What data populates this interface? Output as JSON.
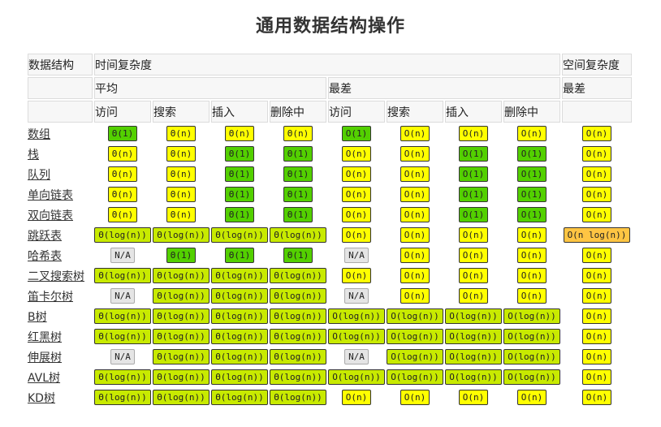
{
  "title": "通用数据结构操作",
  "headers": {
    "structure": "数据结构",
    "time": "时间复杂度",
    "space": "空间复杂度",
    "average": "平均",
    "worst": "最差",
    "space_worst": "最差",
    "ops": [
      "访问",
      "搜索",
      "插入",
      "删除中",
      "访问",
      "搜索",
      "插入",
      "删除中"
    ]
  },
  "colors": {
    "g": "#53d000",
    "lg": "#c8ea00",
    "y": "#ffff00",
    "o": "#ffc543",
    "na": "#e5e5e5"
  },
  "rows": [
    {
      "name": "数组",
      "cells": [
        [
          "Θ(1)",
          "g"
        ],
        [
          "Θ(n)",
          "y"
        ],
        [
          "Θ(n)",
          "y"
        ],
        [
          "Θ(n)",
          "y"
        ],
        [
          "O(1)",
          "g"
        ],
        [
          "O(n)",
          "y"
        ],
        [
          "O(n)",
          "y"
        ],
        [
          "O(n)",
          "y"
        ],
        [
          "O(n)",
          "y"
        ]
      ]
    },
    {
      "name": "栈",
      "cells": [
        [
          "Θ(n)",
          "y"
        ],
        [
          "Θ(n)",
          "y"
        ],
        [
          "Θ(1)",
          "g"
        ],
        [
          "Θ(1)",
          "g"
        ],
        [
          "O(n)",
          "y"
        ],
        [
          "O(n)",
          "y"
        ],
        [
          "O(1)",
          "g"
        ],
        [
          "O(1)",
          "g"
        ],
        [
          "O(n)",
          "y"
        ]
      ]
    },
    {
      "name": "队列",
      "cells": [
        [
          "Θ(n)",
          "y"
        ],
        [
          "Θ(n)",
          "y"
        ],
        [
          "Θ(1)",
          "g"
        ],
        [
          "Θ(1)",
          "g"
        ],
        [
          "O(n)",
          "y"
        ],
        [
          "O(n)",
          "y"
        ],
        [
          "O(1)",
          "g"
        ],
        [
          "O(1)",
          "g"
        ],
        [
          "O(n)",
          "y"
        ]
      ]
    },
    {
      "name": "单向链表",
      "cells": [
        [
          "Θ(n)",
          "y"
        ],
        [
          "Θ(n)",
          "y"
        ],
        [
          "Θ(1)",
          "g"
        ],
        [
          "Θ(1)",
          "g"
        ],
        [
          "O(n)",
          "y"
        ],
        [
          "O(n)",
          "y"
        ],
        [
          "O(1)",
          "g"
        ],
        [
          "O(1)",
          "g"
        ],
        [
          "O(n)",
          "y"
        ]
      ]
    },
    {
      "name": "双向链表",
      "cells": [
        [
          "Θ(n)",
          "y"
        ],
        [
          "Θ(n)",
          "y"
        ],
        [
          "Θ(1)",
          "g"
        ],
        [
          "Θ(1)",
          "g"
        ],
        [
          "O(n)",
          "y"
        ],
        [
          "O(n)",
          "y"
        ],
        [
          "O(1)",
          "g"
        ],
        [
          "O(1)",
          "g"
        ],
        [
          "O(n)",
          "y"
        ]
      ]
    },
    {
      "name": "跳跃表",
      "cells": [
        [
          "Θ(log(n))",
          "lg"
        ],
        [
          "Θ(log(n))",
          "lg"
        ],
        [
          "Θ(log(n))",
          "lg"
        ],
        [
          "Θ(log(n))",
          "lg"
        ],
        [
          "O(n)",
          "y"
        ],
        [
          "O(n)",
          "y"
        ],
        [
          "O(n)",
          "y"
        ],
        [
          "O(n)",
          "y"
        ],
        [
          "O(n log(n))",
          "o"
        ]
      ]
    },
    {
      "name": "哈希表",
      "cells": [
        [
          "N/A",
          "na"
        ],
        [
          "Θ(1)",
          "g"
        ],
        [
          "Θ(1)",
          "g"
        ],
        [
          "Θ(1)",
          "g"
        ],
        [
          "N/A",
          "na"
        ],
        [
          "O(n)",
          "y"
        ],
        [
          "O(n)",
          "y"
        ],
        [
          "O(n)",
          "y"
        ],
        [
          "O(n)",
          "y"
        ]
      ]
    },
    {
      "name": "二叉搜索树",
      "cells": [
        [
          "Θ(log(n))",
          "lg"
        ],
        [
          "Θ(log(n))",
          "lg"
        ],
        [
          "Θ(log(n))",
          "lg"
        ],
        [
          "Θ(log(n))",
          "lg"
        ],
        [
          "O(n)",
          "y"
        ],
        [
          "O(n)",
          "y"
        ],
        [
          "O(n)",
          "y"
        ],
        [
          "O(n)",
          "y"
        ],
        [
          "O(n)",
          "y"
        ]
      ]
    },
    {
      "name": "笛卡尔树",
      "cells": [
        [
          "N/A",
          "na"
        ],
        [
          "Θ(log(n))",
          "lg"
        ],
        [
          "Θ(log(n))",
          "lg"
        ],
        [
          "Θ(log(n))",
          "lg"
        ],
        [
          "N/A",
          "na"
        ],
        [
          "O(n)",
          "y"
        ],
        [
          "O(n)",
          "y"
        ],
        [
          "O(n)",
          "y"
        ],
        [
          "O(n)",
          "y"
        ]
      ]
    },
    {
      "name": "B树",
      "cells": [
        [
          "Θ(log(n))",
          "lg"
        ],
        [
          "Θ(log(n))",
          "lg"
        ],
        [
          "Θ(log(n))",
          "lg"
        ],
        [
          "Θ(log(n))",
          "lg"
        ],
        [
          "O(log(n))",
          "lg"
        ],
        [
          "O(log(n))",
          "lg"
        ],
        [
          "O(log(n))",
          "lg"
        ],
        [
          "O(log(n))",
          "lg"
        ],
        [
          "O(n)",
          "y"
        ]
      ]
    },
    {
      "name": "红黑树",
      "cells": [
        [
          "Θ(log(n))",
          "lg"
        ],
        [
          "Θ(log(n))",
          "lg"
        ],
        [
          "Θ(log(n))",
          "lg"
        ],
        [
          "Θ(log(n))",
          "lg"
        ],
        [
          "O(log(n))",
          "lg"
        ],
        [
          "O(log(n))",
          "lg"
        ],
        [
          "O(log(n))",
          "lg"
        ],
        [
          "O(log(n))",
          "lg"
        ],
        [
          "O(n)",
          "y"
        ]
      ]
    },
    {
      "name": "伸展树",
      "cells": [
        [
          "N/A",
          "na"
        ],
        [
          "Θ(log(n))",
          "lg"
        ],
        [
          "Θ(log(n))",
          "lg"
        ],
        [
          "Θ(log(n))",
          "lg"
        ],
        [
          "N/A",
          "na"
        ],
        [
          "O(log(n))",
          "lg"
        ],
        [
          "O(log(n))",
          "lg"
        ],
        [
          "O(log(n))",
          "lg"
        ],
        [
          "O(n)",
          "y"
        ]
      ]
    },
    {
      "name": "AVL树",
      "cells": [
        [
          "Θ(log(n))",
          "lg"
        ],
        [
          "Θ(log(n))",
          "lg"
        ],
        [
          "Θ(log(n))",
          "lg"
        ],
        [
          "Θ(log(n))",
          "lg"
        ],
        [
          "O(log(n))",
          "lg"
        ],
        [
          "O(log(n))",
          "lg"
        ],
        [
          "O(log(n))",
          "lg"
        ],
        [
          "O(log(n))",
          "lg"
        ],
        [
          "O(n)",
          "y"
        ]
      ]
    },
    {
      "name": "KD树",
      "cells": [
        [
          "Θ(log(n))",
          "lg"
        ],
        [
          "Θ(log(n))",
          "lg"
        ],
        [
          "Θ(log(n))",
          "lg"
        ],
        [
          "Θ(log(n))",
          "lg"
        ],
        [
          "O(n)",
          "y"
        ],
        [
          "O(n)",
          "y"
        ],
        [
          "O(n)",
          "y"
        ],
        [
          "O(n)",
          "y"
        ],
        [
          "O(n)",
          "y"
        ]
      ]
    }
  ]
}
